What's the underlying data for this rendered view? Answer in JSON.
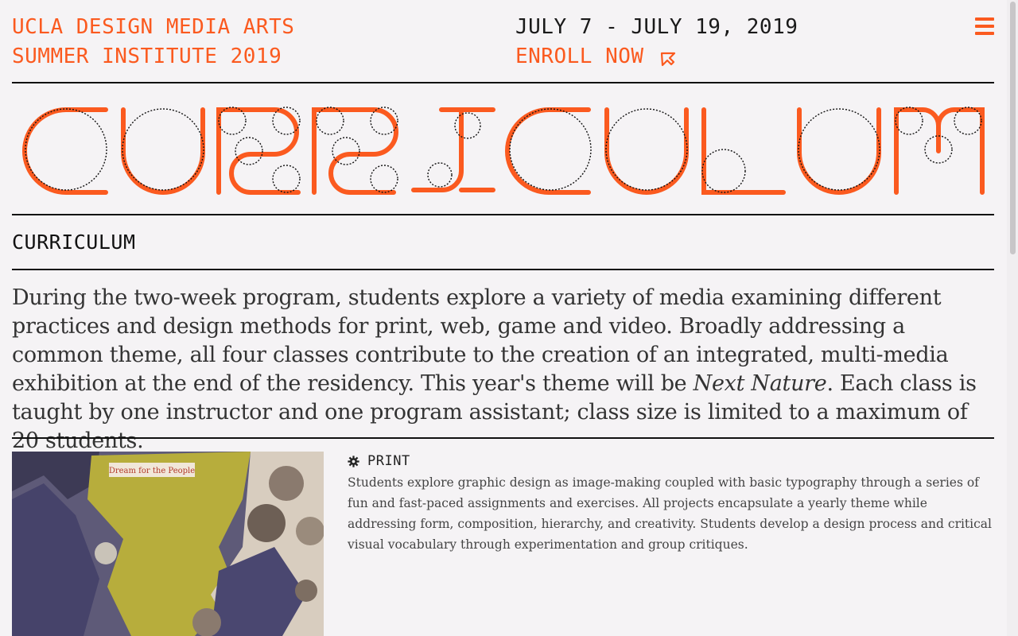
{
  "header": {
    "title_line1": "UCLA DESIGN MEDIA ARTS",
    "title_line2": "SUMMER INSTITUTE 2019",
    "dates": "JULY 7 - JULY 19, 2019",
    "enroll_label": "ENROLL NOW",
    "enroll_icon": "arrow-cursor-icon",
    "menu_icon": "hamburger-menu-icon"
  },
  "banner": {
    "word": "CURRICULUM",
    "style": "gear-outline-display-lettering",
    "color": "#fb5a1f"
  },
  "section": {
    "label": "CURRICULUM"
  },
  "intro": {
    "before": "During the two-week program, students explore a variety of media examining different practices and design methods for print, web, game and video. Broadly addressing a common theme, all four classes contribute to the creation of an integrated, multi-media exhibition at the end of the residency. This year's theme will be ",
    "theme": "Next Nature",
    "after": ". Each class is taught by one instructor and one program assistant; class size is limited to a maximum of 20 students."
  },
  "courses": [
    {
      "name": "PRINT",
      "icon": "gear-icon",
      "image_caption": "Dream for the People",
      "description": "Students explore graphic design as image-making coupled with basic typography through a series of fun and fast-paced assignments and exercises. All projects encapsulate a yearly theme while addressing form, composition, hierarchy, and creativity. Students develop a design process and critical visual vocabulary through experimentation and group critiques."
    }
  ],
  "colors": {
    "accent": "#fb5a1f",
    "background": "#f5f3f5",
    "text": "#1a1a1a",
    "rule": "#111111"
  }
}
